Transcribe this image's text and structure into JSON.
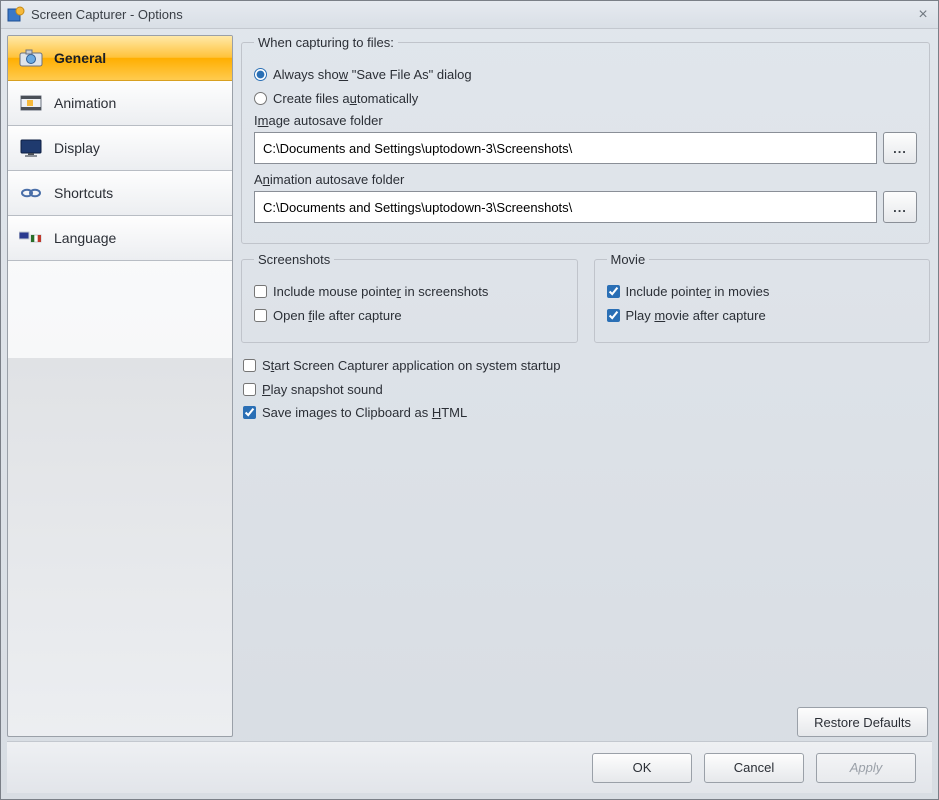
{
  "window": {
    "title": "Screen Capturer - Options"
  },
  "sidebar": {
    "items": [
      {
        "label": "General"
      },
      {
        "label": "Animation"
      },
      {
        "label": "Display"
      },
      {
        "label": "Shortcuts"
      },
      {
        "label": "Language"
      }
    ]
  },
  "capture_group": {
    "legend": "When capturing to files:",
    "radio_show_dialog": "Always show \"Save File As\" dialog",
    "radio_auto": "Create files automatically",
    "image_folder_label": "Image autosave folder",
    "image_folder_value": "C:\\Documents and Settings\\uptodown-3\\Screenshots\\",
    "anim_folder_label": "Animation autosave folder",
    "anim_folder_value": "C:\\Documents and Settings\\uptodown-3\\Screenshots\\",
    "browse_label": "..."
  },
  "screenshots_group": {
    "legend": "Screenshots",
    "include_pointer": "Include mouse pointer in screenshots",
    "open_after": "Open file after capture"
  },
  "movie_group": {
    "legend": "Movie",
    "include_pointer": "Include pointer in movies",
    "play_after": "Play movie after capture"
  },
  "misc": {
    "startup": "Start Screen Capturer application on system startup",
    "sound": "Play snapshot sound",
    "clipboard": "Save images to Clipboard as HTML"
  },
  "buttons": {
    "restore": "Restore Defaults",
    "ok": "OK",
    "cancel": "Cancel",
    "apply": "Apply"
  }
}
